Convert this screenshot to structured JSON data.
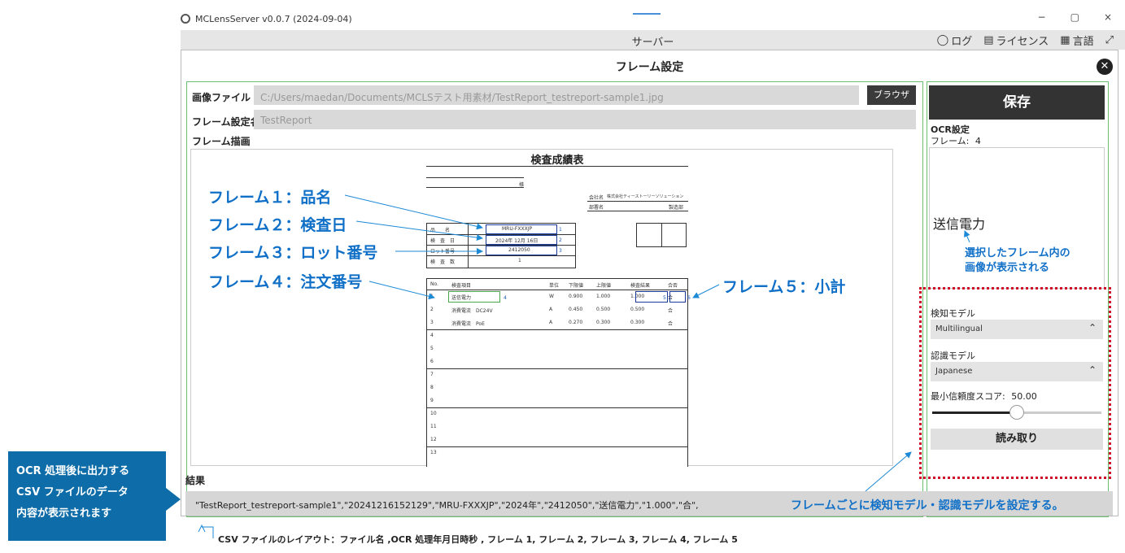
{
  "window": {
    "title": "MCLensServer v0.0.7 (2024-09-04)",
    "minimize": "−",
    "restore": "▢",
    "close": "×"
  },
  "menubar": {
    "center": "サーバー",
    "log": "ログ",
    "license": "ライセンス",
    "language": "言語"
  },
  "dialog": {
    "title": "フレーム設定",
    "image_file_label": "画像ファイル",
    "image_file_value": "C:/Users/maedan/Documents/MCLSテスト用素材/TestReport_testreport-sample1.jpg",
    "browse_label": "ブラウザ",
    "frame_name_label": "フレーム設定名",
    "frame_name_value": "TestReport",
    "frame_draw_label": "フレーム描画",
    "result_label": "結果",
    "result_value": "\"TestReport_testreport-sample1\",\"20241216152129\",\"MRU-FXXXJP\",\"2024年\",\"2412050\",\"送信電力\",\"1.000\",\"合\","
  },
  "document": {
    "title": "検査成績表",
    "sama": "様",
    "company_label": "会社名",
    "company_value": "株式会社ティーストーリーソリューション",
    "dept_label": "部署名",
    "dept_value": "製造部",
    "info_rows": [
      {
        "label": "品　　名",
        "value": "MRU-FXXXJP",
        "num": "1"
      },
      {
        "label": "検　査　日",
        "value": "2024年 12月 16日",
        "num": "2"
      },
      {
        "label": "ロット番号",
        "value": "2412050",
        "num": "3"
      },
      {
        "label": "検　査　数",
        "value": "1",
        "num": ""
      }
    ],
    "table_headers": [
      "No.",
      "検査項目",
      "単位",
      "下限値",
      "上限値",
      "検査結果",
      "合否"
    ],
    "table_rows": [
      {
        "no": "1",
        "item": "送信電力",
        "unit": "W",
        "min": "0.900",
        "max": "1.000",
        "result": "1.000",
        "pass": "合"
      },
      {
        "no": "2",
        "item": "消費電流　DC24V",
        "unit": "A",
        "min": "0.450",
        "max": "0.500",
        "result": "0.500",
        "pass": "合"
      },
      {
        "no": "3",
        "item": "消費電流　PoE",
        "unit": "A",
        "min": "0.270",
        "max": "0.300",
        "result": "0.300",
        "pass": "合"
      },
      {
        "no": "4"
      },
      {
        "no": "5"
      },
      {
        "no": "6"
      },
      {
        "no": "7"
      },
      {
        "no": "8"
      },
      {
        "no": "9"
      },
      {
        "no": "10"
      },
      {
        "no": "11"
      },
      {
        "no": "12"
      },
      {
        "no": "13"
      }
    ],
    "frame_markers": {
      "f4": "4",
      "f5": "5",
      "f6": "6"
    }
  },
  "annotations": {
    "frame1": "フレーム１：品名",
    "frame2": "フレーム２：検査日",
    "frame3": "フレーム３：ロット番号",
    "frame4": "フレーム４：注文番号",
    "frame5": "フレーム５：小計",
    "selected_note_1": "選択したフレーム内の",
    "selected_note_2": "画像が表示される",
    "model_note": "フレームごとに検知モデル・認識モデルを設定する。",
    "left_callout_1": "OCR 処理後に出力する",
    "left_callout_2": "CSV ファイルのデータ",
    "left_callout_3": "内容が表示されます",
    "csv_layout": "CSV ファイルのレイアウト：ファイル名 ,OCR 処理年月日時秒 , フレーム 1, フレーム 2, フレーム 3, フレーム 4, フレーム 5"
  },
  "ocr": {
    "save_label": "保存",
    "settings_label": "OCR設定",
    "frame_label": "フレーム:",
    "frame_value": "4",
    "preview_text": "送信電力",
    "detect_model_label": "検知モデル",
    "detect_model_value": "Multilingual",
    "recog_model_label": "認識モデル",
    "recog_model_value": "Japanese",
    "min_score_label": "最小信頼度スコア:",
    "min_score_value": "50.00",
    "min_score_fraction": 0.5,
    "read_button": "読み取り"
  },
  "colors": {
    "annotation_blue": "#1070c8",
    "callout_blue": "#0e6da8",
    "panel_border_green": "#6cbf6c",
    "dotted_red": "#d0102a"
  }
}
